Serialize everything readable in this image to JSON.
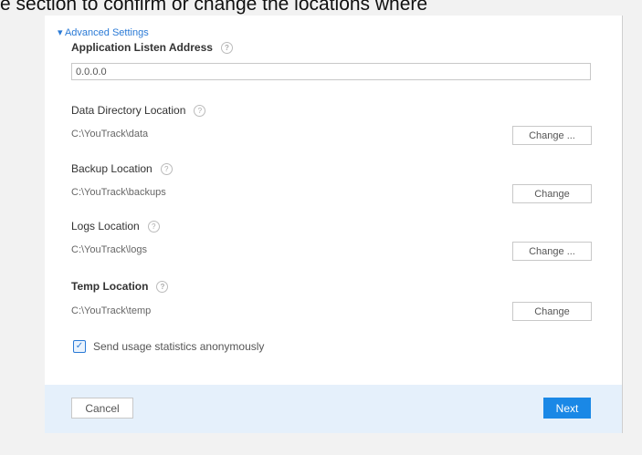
{
  "caption": "e section to confirm or change the locations where",
  "dialog": {
    "section_toggle": "▾ Advanced Settings",
    "listen_address": {
      "label": "Application Listen Address",
      "value": "0.0.0.0",
      "help_icon": "question-circle-icon"
    },
    "locations": [
      {
        "label": "Data Directory Location",
        "path": "C:\\YouTrack\\data",
        "button": "Change ..."
      },
      {
        "label": "Backup Location",
        "path": "C:\\YouTrack\\backups",
        "button": "Change"
      },
      {
        "label": "Logs Location",
        "path": "C:\\YouTrack\\logs",
        "button": "Change ..."
      },
      {
        "label": "Temp Location",
        "path": "C:\\YouTrack\\temp",
        "button": "Change"
      }
    ],
    "statistics_checkbox": {
      "label": "Send usage statistics anonymously",
      "checked": true
    }
  },
  "footer": {
    "cancel_label": "Cancel",
    "next_label": "Next"
  },
  "colors": {
    "accent": "#1a88e6",
    "footer_bg": "#e5f0fb",
    "page_bg": "#f2f2f2"
  }
}
